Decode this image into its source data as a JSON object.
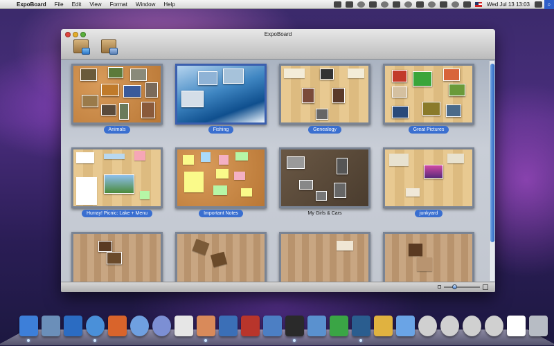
{
  "menubar": {
    "apple_glyph": "",
    "app_name": "ExpoBoard",
    "menus": [
      "File",
      "Edit",
      "View",
      "Format",
      "Window",
      "Help"
    ],
    "clock": "Wed Jul 13  13:03"
  },
  "window": {
    "title": "ExpoBoard",
    "toolbar": [
      {
        "name": "add-board",
        "icon": "add-board-icon"
      },
      {
        "name": "remove-board",
        "icon": "remove-board-icon"
      }
    ]
  },
  "boards": [
    {
      "label": "Animals",
      "selected": false
    },
    {
      "label": "Fishing",
      "selected": true
    },
    {
      "label": "Genealogy",
      "selected": false
    },
    {
      "label": "Great Pictures",
      "selected": false
    },
    {
      "label": "Hurray! Picnic: Lake + Menu",
      "selected": false
    },
    {
      "label": "Important Notes",
      "selected": false
    },
    {
      "label": "My Girls & Cars",
      "selected": false
    },
    {
      "label": "junkyard",
      "selected": false
    }
  ],
  "dock": [
    {
      "name": "finder",
      "color": "#3d7fd9"
    },
    {
      "name": "preview",
      "color": "#6b8fb9"
    },
    {
      "name": "thunderbird",
      "color": "#2b6cc2"
    },
    {
      "name": "safari",
      "color": "#4a90d9"
    },
    {
      "name": "firefox",
      "color": "#d9642b"
    },
    {
      "name": "ichat",
      "color": "#6fa0e0"
    },
    {
      "name": "itunes",
      "color": "#7c8fd4"
    },
    {
      "name": "textedit",
      "color": "#e6e6e6"
    },
    {
      "name": "expoboard",
      "color": "#d98a5a"
    },
    {
      "name": "dictionary",
      "color": "#3b6fb7"
    },
    {
      "name": "calendar",
      "color": "#b8352b"
    },
    {
      "name": "xcode",
      "color": "#4c7fc4"
    },
    {
      "name": "terminal",
      "color": "#2a2a2a"
    },
    {
      "name": "screen-sharing",
      "color": "#5a91cf"
    },
    {
      "name": "downloader",
      "color": "#3aa545"
    },
    {
      "name": "photoshop",
      "color": "#2a5d8f"
    },
    {
      "name": "mail-stamp",
      "color": "#e0b240"
    },
    {
      "name": "folder",
      "color": "#6aa4e6"
    },
    {
      "name": "at-sign-1",
      "color": "#d0d0d0"
    },
    {
      "name": "at-sign-2",
      "color": "#d0d0d0"
    },
    {
      "name": "at-sign-3",
      "color": "#d0d0d0"
    },
    {
      "name": "at-sign-4",
      "color": "#d0d0d0"
    },
    {
      "name": "document",
      "color": "#ffffff"
    },
    {
      "name": "trash",
      "color": "#b7bcc4"
    }
  ]
}
